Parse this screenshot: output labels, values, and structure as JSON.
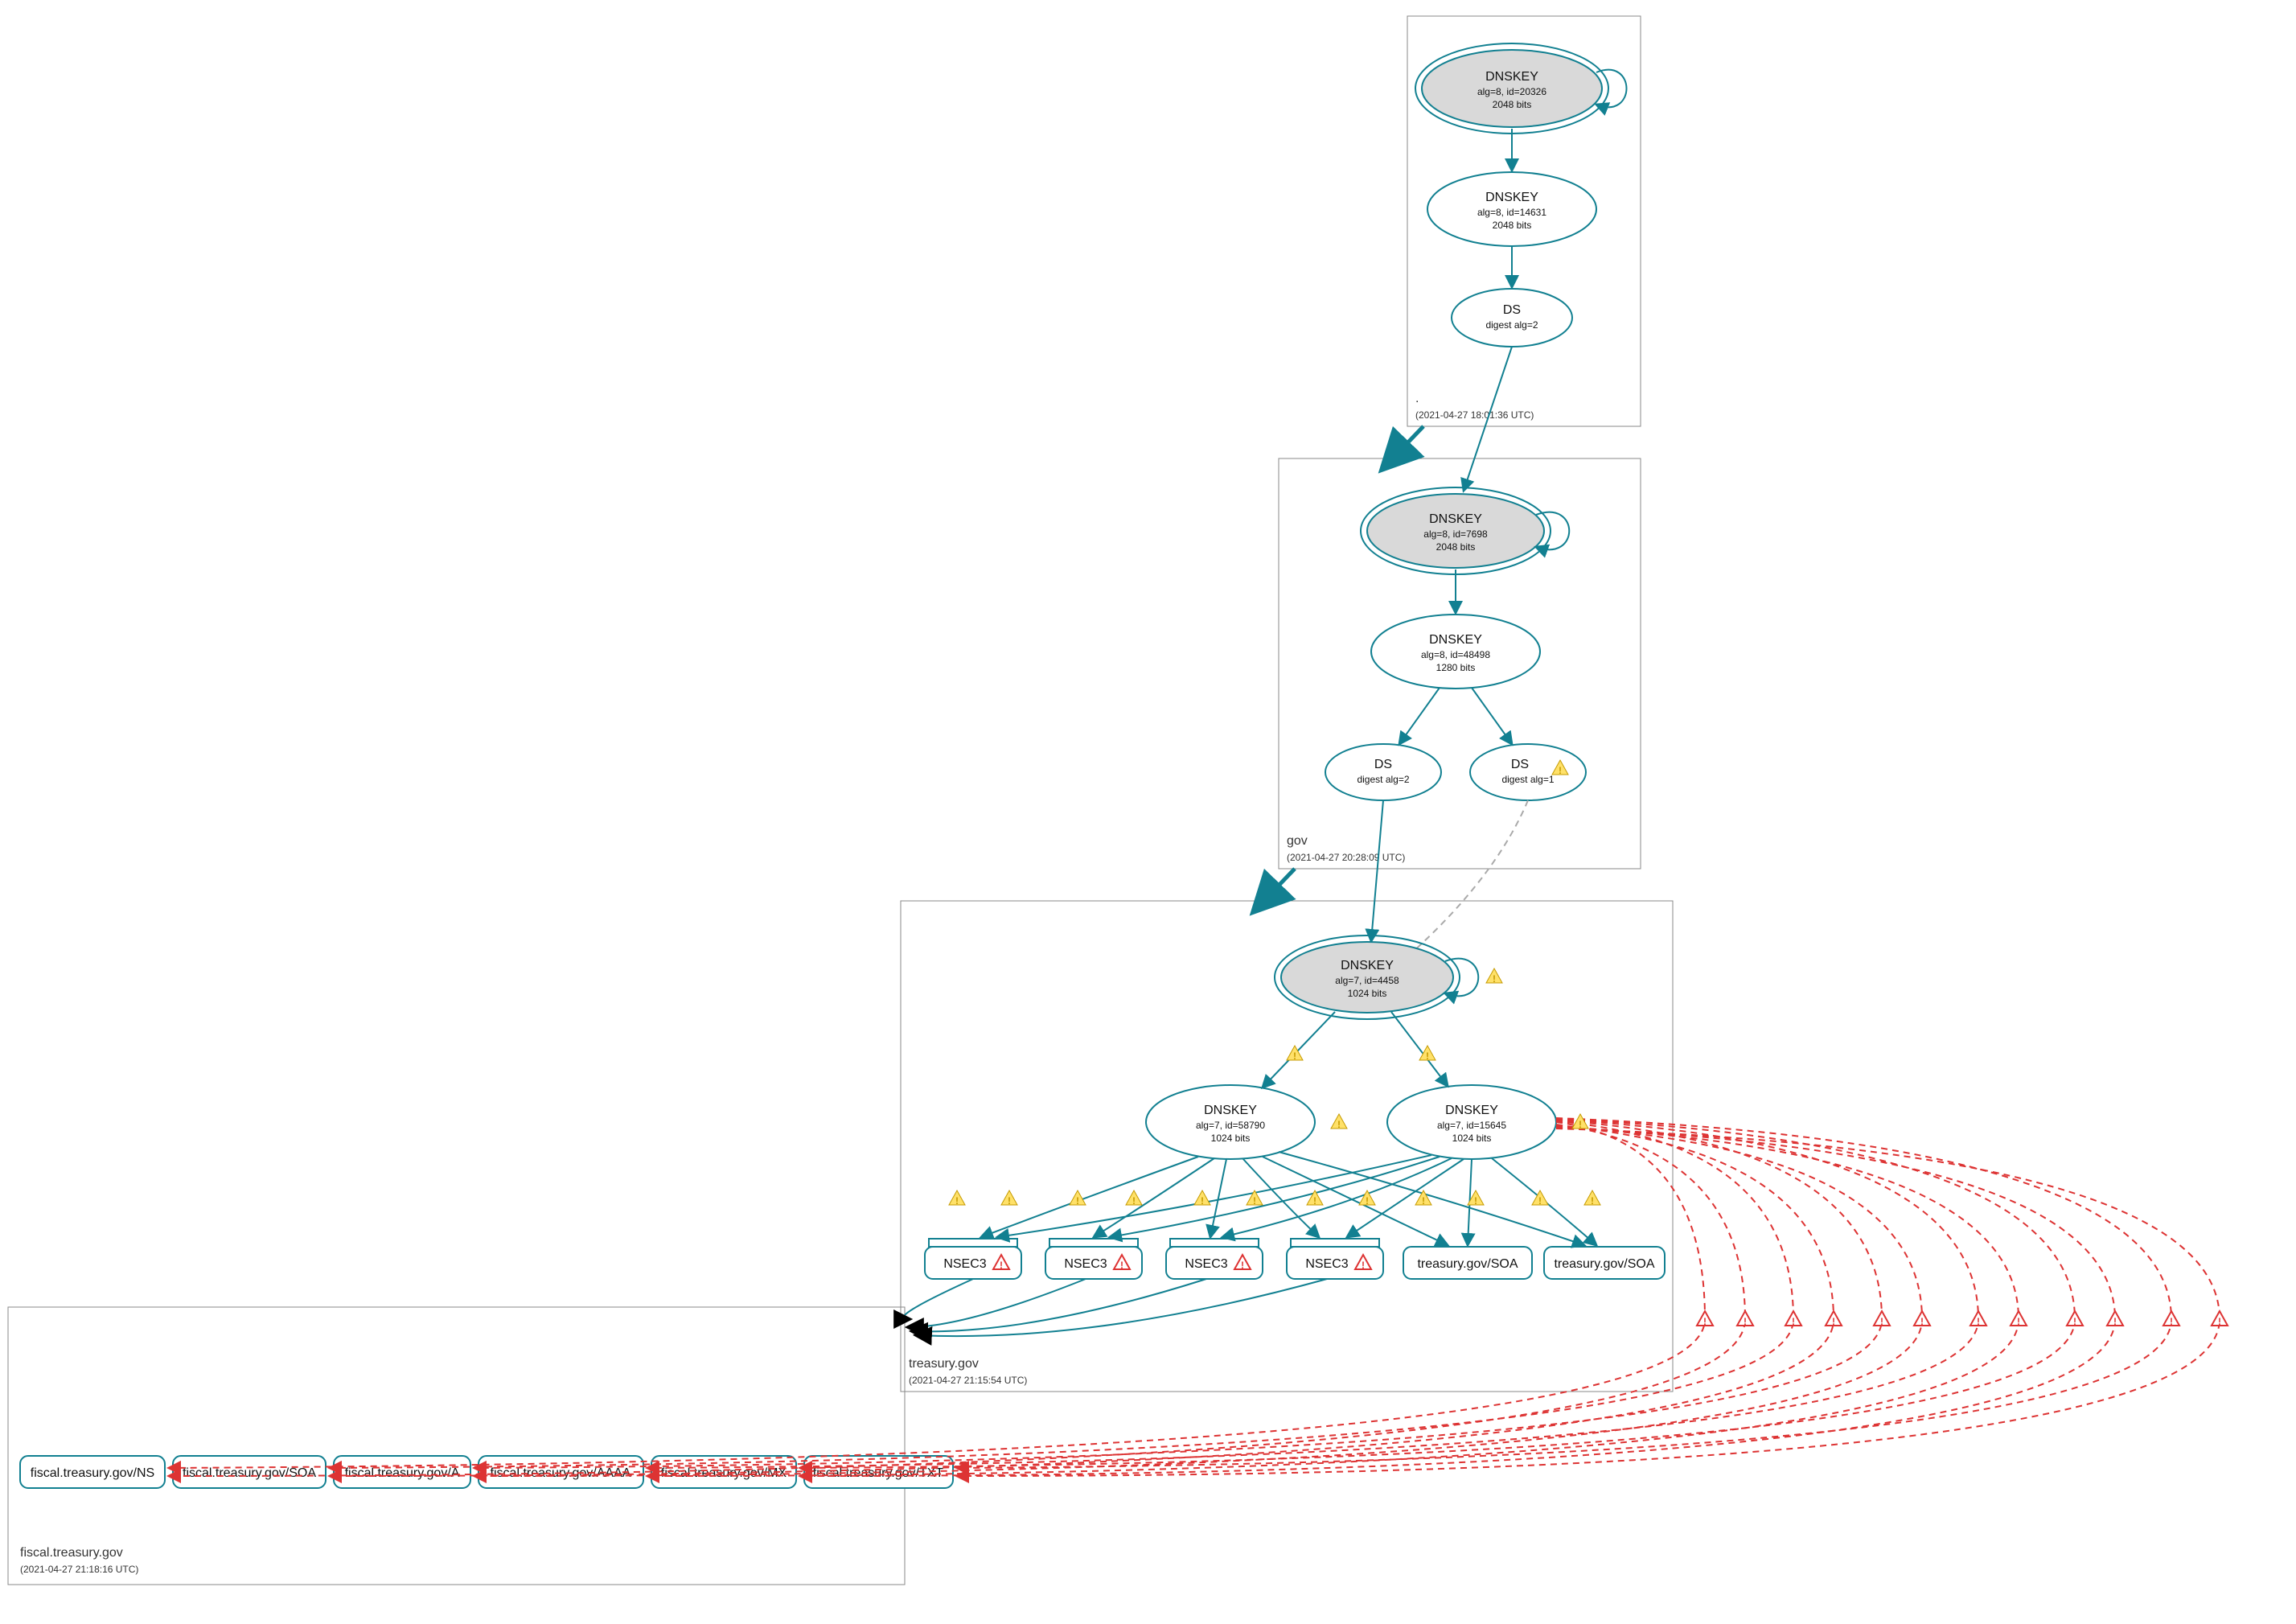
{
  "zones": {
    "root": {
      "label": ".",
      "timestamp": "(2021-04-27 18:01:36 UTC)"
    },
    "gov": {
      "label": "gov",
      "timestamp": "(2021-04-27 20:28:09 UTC)"
    },
    "treasury": {
      "label": "treasury.gov",
      "timestamp": "(2021-04-27 21:15:54 UTC)"
    },
    "fiscal": {
      "label": "fiscal.treasury.gov",
      "timestamp": "(2021-04-27 21:18:16 UTC)"
    }
  },
  "nodes": {
    "root_ksk": {
      "title": "DNSKEY",
      "sub1": "alg=8, id=20326",
      "sub2": "2048 bits"
    },
    "root_zsk": {
      "title": "DNSKEY",
      "sub1": "alg=8, id=14631",
      "sub2": "2048 bits"
    },
    "root_ds": {
      "title": "DS",
      "sub1": "digest alg=2"
    },
    "gov_ksk": {
      "title": "DNSKEY",
      "sub1": "alg=8, id=7698",
      "sub2": "2048 bits"
    },
    "gov_zsk": {
      "title": "DNSKEY",
      "sub1": "alg=8, id=48498",
      "sub2": "1280 bits"
    },
    "gov_ds1": {
      "title": "DS",
      "sub1": "digest alg=2"
    },
    "gov_ds2": {
      "title": "DS",
      "sub1": "digest alg=1"
    },
    "tre_ksk": {
      "title": "DNSKEY",
      "sub1": "alg=7, id=4458",
      "sub2": "1024 bits"
    },
    "tre_zsk1": {
      "title": "DNSKEY",
      "sub1": "alg=7, id=58790",
      "sub2": "1024 bits"
    },
    "tre_zsk2": {
      "title": "DNSKEY",
      "sub1": "alg=7, id=15645",
      "sub2": "1024 bits"
    }
  },
  "rr": {
    "nsec3_1": "NSEC3",
    "nsec3_2": "NSEC3",
    "nsec3_3": "NSEC3",
    "nsec3_4": "NSEC3",
    "soa1": "treasury.gov/SOA",
    "soa2": "treasury.gov/SOA",
    "f_ns": "fiscal.treasury.gov/NS",
    "f_soa": "fiscal.treasury.gov/SOA",
    "f_a": "fiscal.treasury.gov/A",
    "f_aaaa": "fiscal.treasury.gov/AAAA",
    "f_mx": "fiscal.treasury.gov/MX",
    "f_txt": "fiscal.treasury.gov/TXT"
  }
}
